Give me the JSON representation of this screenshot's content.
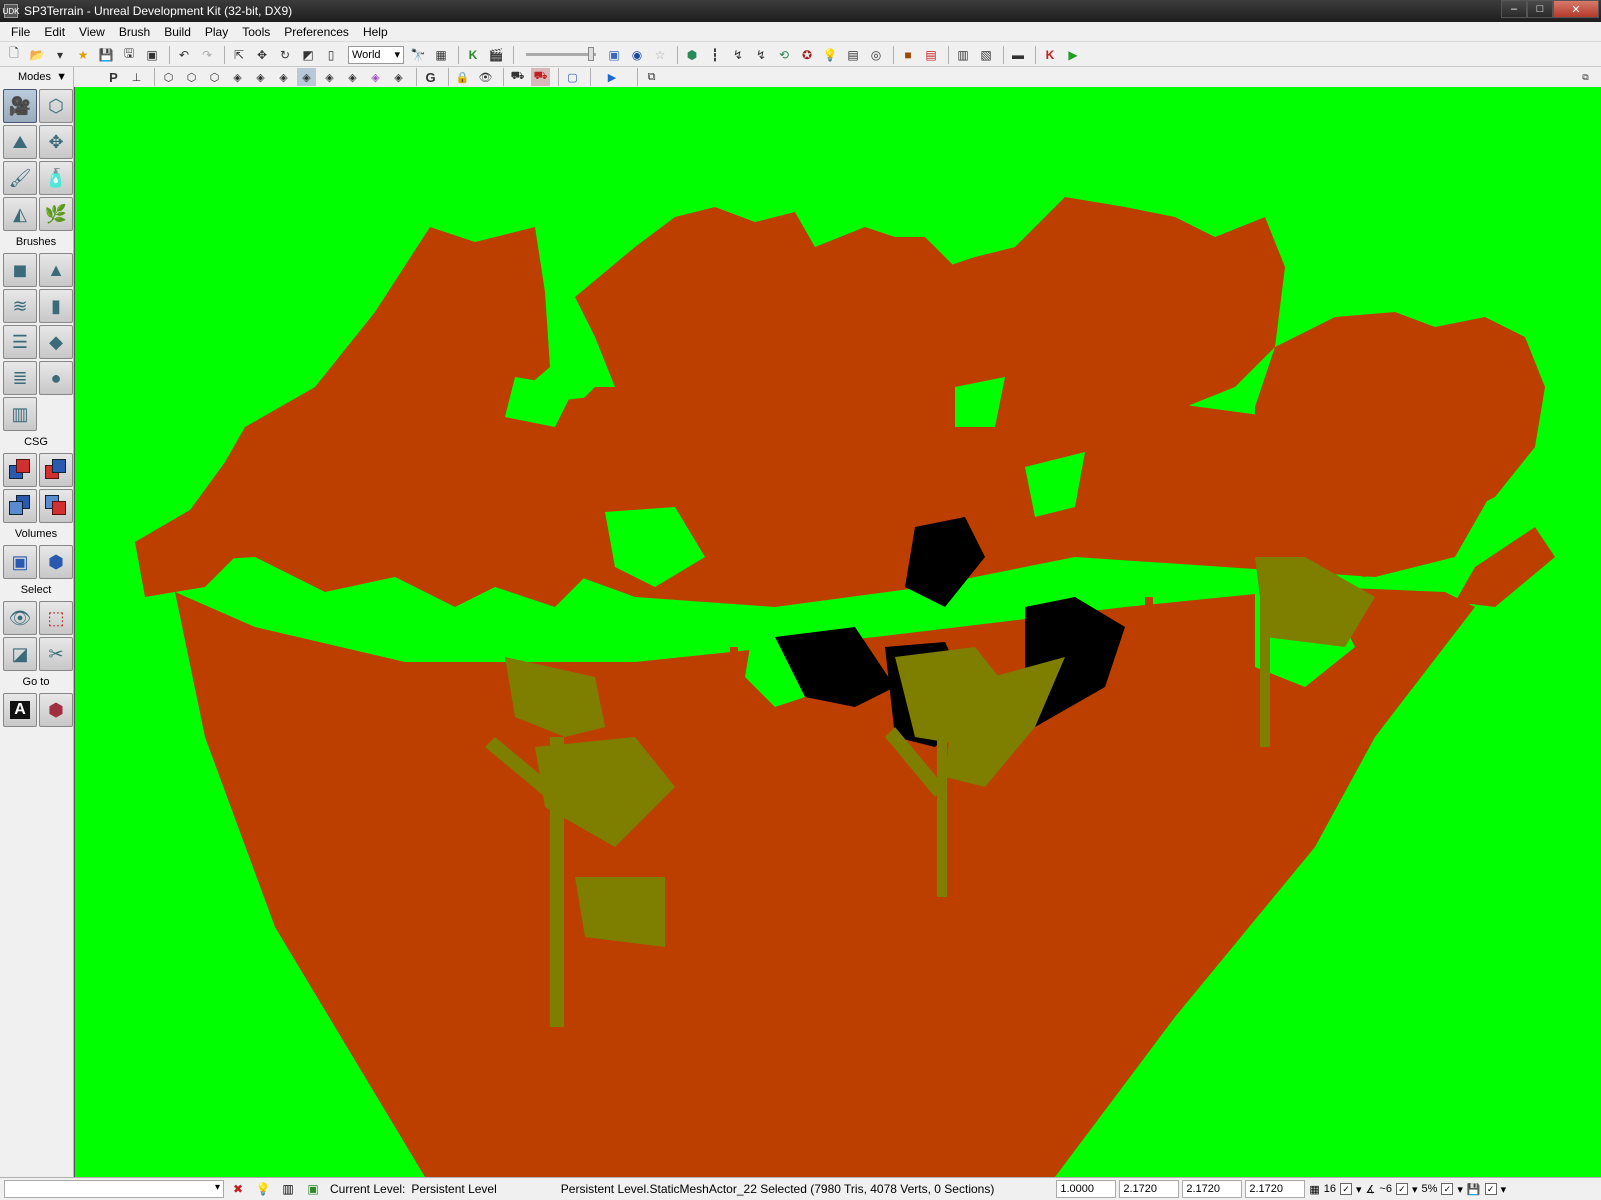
{
  "window": {
    "title": "SP3Terrain - Unreal Development Kit (32-bit, DX9)",
    "app_badge": "UDK",
    "buttons": [
      "–",
      "□",
      "✕"
    ]
  },
  "menu": [
    "File",
    "Edit",
    "View",
    "Brush",
    "Build",
    "Play",
    "Tools",
    "Preferences",
    "Help"
  ],
  "toolbar": {
    "coordinate_system": "World"
  },
  "viewport_toolbar": {
    "perspective_label": "P",
    "grid_label": "G"
  },
  "modes_panel": {
    "modes_label": "Modes",
    "brushes_label": "Brushes",
    "csg_label": "CSG",
    "volumes_label": "Volumes",
    "select_label": "Select",
    "goto_label": "Go to",
    "goto_actor_letter": "A"
  },
  "viewport": {
    "background_color": "#00ff00",
    "ground_color": "#bc3f00",
    "tree_color": "#7e7e00",
    "shadow_color": "#000000"
  },
  "statusbar": {
    "current_level_label": "Current Level:",
    "current_level_value": "Persistent Level",
    "selection_info": "Persistent Level.StaticMeshActor_22 Selected (7980 Tris, 4078 Verts, 0 Sections)",
    "drag_grid": "1.0000",
    "scale_x": "2.1720",
    "scale_y": "2.1720",
    "scale_z": "2.1720",
    "grid_size": "16",
    "rotation_snap": "~6",
    "scale_snap": "5%"
  }
}
